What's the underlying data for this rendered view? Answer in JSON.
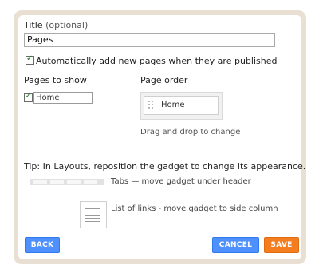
{
  "form": {
    "title_label": "Title",
    "title_optional": "(optional)",
    "title_value": "Pages",
    "auto_add_label": "Automatically add new pages when they are published",
    "auto_add_checked": true
  },
  "pages_to_show": {
    "heading": "Pages to show",
    "items": [
      {
        "label": "Home",
        "checked": true
      }
    ]
  },
  "page_order": {
    "heading": "Page order",
    "items": [
      "Home"
    ],
    "hint": "Drag and drop to change"
  },
  "tip": {
    "text": "Tip: In Layouts, reposition the gadget to change its appearance.",
    "tabs_desc": "Tabs — move gadget under header",
    "list_desc": "List of links - move gadget to side column"
  },
  "buttons": {
    "back": "BACK",
    "cancel": "CANCEL",
    "save": "SAVE"
  },
  "colors": {
    "frame": "#e9dfd2",
    "primary_button": "#4d90fe",
    "save_button": "#f47d20"
  }
}
